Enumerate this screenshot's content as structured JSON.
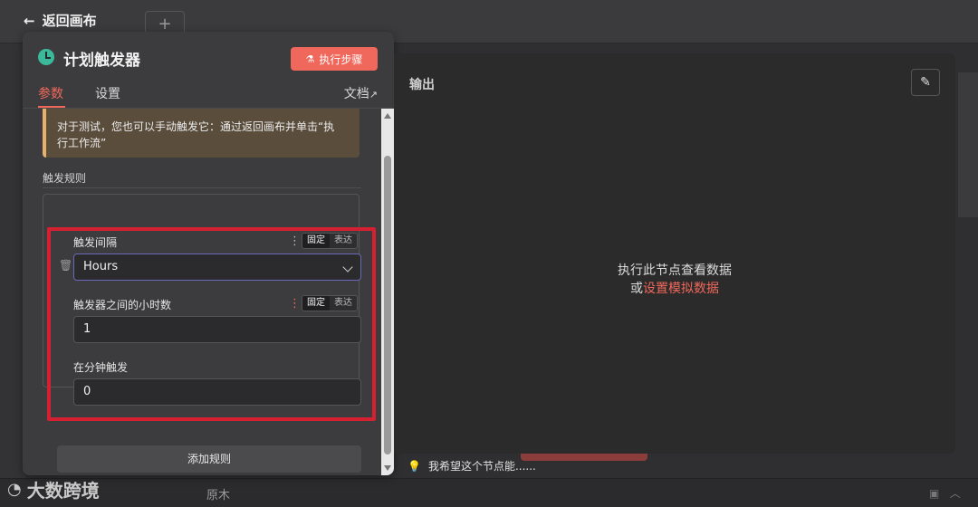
{
  "nav": {
    "back_label": "返回画布",
    "new_tab": "+"
  },
  "panel": {
    "title": "计划触发器",
    "execute_button": "执行步骤",
    "tabs": [
      {
        "label": "参数",
        "active": true
      },
      {
        "label": "设置",
        "active": false
      }
    ],
    "docs_label": "文档"
  },
  "notice": {
    "line1": "对于测试，您也可以手动触发它：通过返回画布并单击“执",
    "line2": "行工作流”"
  },
  "trigger_rules": {
    "section_title": "触发规则",
    "fields": [
      {
        "label": "触发间隔",
        "type": "select",
        "value": "Hours",
        "mode_fixed": "固定",
        "mode_expression": "表达"
      },
      {
        "label": "触发器之间的小时数",
        "type": "number",
        "value": "1",
        "mode_fixed": "固定",
        "mode_expression": "表达"
      },
      {
        "label": "在分钟触发",
        "type": "number",
        "value": "0"
      }
    ],
    "add_rule_button": "添加规则"
  },
  "output": {
    "title": "输出",
    "empty_message": "执行此节点查看数据",
    "or": "或",
    "mock_link": "设置模拟数据"
  },
  "hint": {
    "text": "我希望这个节点能......"
  },
  "background": {
    "bottom_label": "原木"
  },
  "watermark": {
    "text": "大数跨境"
  },
  "colors": {
    "accent": "#f0685b",
    "notice_bg": "#5a4d3c",
    "notice_border": "#e5b16c",
    "highlight": "#d42030",
    "trigger_icon": "#3bb99a"
  }
}
